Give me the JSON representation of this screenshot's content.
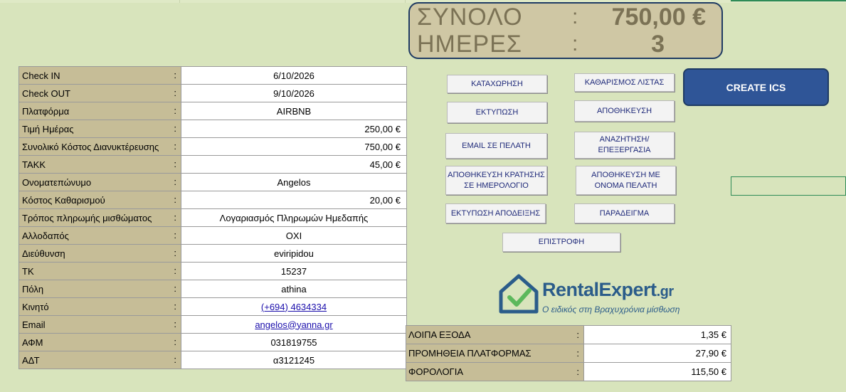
{
  "summary": {
    "total_label": "ΣΥΝΟΛΟ",
    "total_value": "750,00 €",
    "days_label": "ΗΜΕΡΕΣ",
    "days_value": "3",
    "colon": ":"
  },
  "form": {
    "rows": [
      {
        "label": "Check IN",
        "value": "6/10/2026"
      },
      {
        "label": "Check OUT",
        "value": "9/10/2026"
      },
      {
        "label": "Πλατφόρμα",
        "value": "AIRBNB"
      },
      {
        "label": "Τιμή Ημέρας",
        "value": "250,00 €"
      },
      {
        "label": "Συνολικό Κόστος Διανυκτέρευσης",
        "value": "750,00 €"
      },
      {
        "label": "ΤΑΚΚ",
        "value": "45,00 €"
      },
      {
        "label": "Ονοματεπώνυμο",
        "value": "Angelos"
      },
      {
        "label": "Κόστος Καθαρισμού",
        "value": "20,00 €"
      },
      {
        "label": "Τρόπος πληρωμής μισθώματος",
        "value": "Λογαριασμός Πληρωμών Ημεδαπής"
      },
      {
        "label": "Αλλοδαπός",
        "value": "ΟΧΙ"
      },
      {
        "label": "Διεύθυνση",
        "value": "eviripidou"
      },
      {
        "label": "ΤΚ",
        "value": "15237"
      },
      {
        "label": "Πόλη",
        "value": "athina"
      },
      {
        "label": "Κινητό",
        "value": "(+694) 4634334"
      },
      {
        "label": "Email",
        "value": "angelos@yanna.gr"
      },
      {
        "label": "ΑΦΜ",
        "value": "031819755"
      },
      {
        "label": "ΑΔΤ",
        "value": "α3121245"
      }
    ],
    "colon": ":"
  },
  "expenses": {
    "rows": [
      {
        "label": "ΛΟΙΠΑ ΕΞΟΔΑ",
        "value": "1,35 €"
      },
      {
        "label": "ΠΡΟΜΗΘΕΙΑ ΠΛΑΤΦΟΡΜΑΣ",
        "value": "27,90 €"
      },
      {
        "label": "ΦΟΡΟΛΟΓΙΑ",
        "value": "115,50 €"
      }
    ]
  },
  "buttons": {
    "register": "ΚΑΤΑΧΩΡΗΣΗ",
    "clear_list": "ΚΑΘΑΡΙΣΜΟΣ ΛΙΣΤΑΣ",
    "print": "ΕΚΤΥΠΩΣΗ",
    "save": "ΑΠΟΘΗΚΕΥΣΗ",
    "email_client": "EMAIL ΣΕ ΠΕΛΑΤΗ",
    "search_edit": "ΑΝΑΖΗΤΗΣΗ/ΕΠΕΞΕΡΓΑΣΙΑ",
    "save_calendar": "ΑΠΟΘΗΚΕΥΣΗ ΚΡΑΤΗΣΗΣ ΣΕ ΗΜΕΡΟΛΟΓΙΟ",
    "save_client_name": "ΑΠΟΘΗΚΕΥΣΗ ΜΕ ΟΝΟΜΑ ΠΕΛΑΤΗ",
    "print_receipt": "ΕΚΤΥΠΩΣΗ ΑΠΟΔΕΙΞΗΣ",
    "example": "ΠΑΡΑΔΕΙΓΜΑ",
    "back": "ΕΠΙΣΤΡΟΦΗ",
    "create_ics": "CREATE ICS"
  },
  "logo": {
    "brand": "RentalExpert",
    "domain": ".gr",
    "tagline": "Ο ειδικός στη Βραχυχρόνια μίσθωση"
  },
  "colors": {
    "sheet_bg": "#d8e4bc",
    "label_bg": "#c6bd97",
    "accent_blue": "#2f5597",
    "brand_blue": "#2b5c8a",
    "check_green": "#5cb85c"
  }
}
